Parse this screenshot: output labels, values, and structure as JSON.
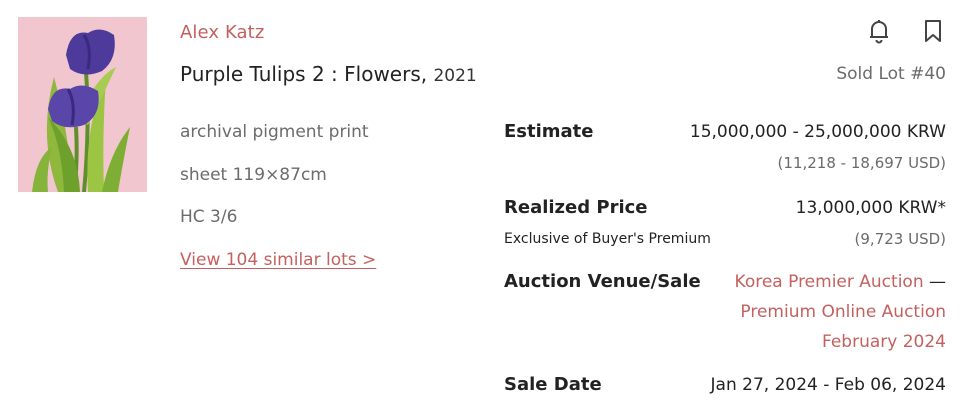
{
  "artist": "Alex Katz",
  "title": "Purple Tulips 2 : Flowers,",
  "year": "2021",
  "medium": "archival pigment print",
  "size": "sheet 119×87cm",
  "edition": "HC 3/6",
  "similar_link": "View 104 similar lots >",
  "lot_status": "Sold Lot #40",
  "estimate": {
    "label": "Estimate",
    "krw": "15,000,000 - 25,000,000 KRW",
    "usd": "(11,218 - 18,697 USD)"
  },
  "realized": {
    "label": "Realized Price",
    "note": "Exclusive of Buyer's Premium",
    "krw": "13,000,000 KRW*",
    "usd": "(9,723 USD)"
  },
  "venue": {
    "label": "Auction Venue/Sale",
    "venue_name": "Korea Premier Auction",
    "separator": " —",
    "sale_name": "Premium Online Auction",
    "sale_month": "February 2024"
  },
  "sale_date": {
    "label": "Sale Date",
    "value": "Jan 27, 2024 - Feb 06, 2024"
  },
  "icons": {
    "alert": "bell-icon",
    "save": "bookmark-icon"
  },
  "colors": {
    "accent": "#c4615f",
    "muted": "#6b6b6b",
    "thumb_bg": "#f2c6cf"
  }
}
